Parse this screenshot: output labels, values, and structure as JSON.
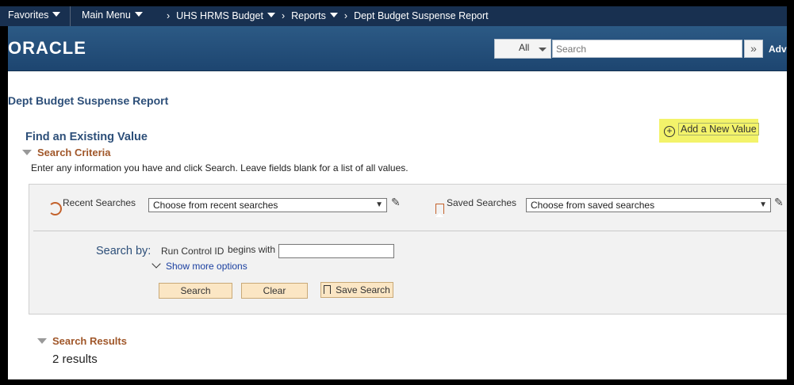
{
  "navbar": {
    "favorites": "Favorites",
    "main_menu": "Main Menu",
    "breadcrumbs": [
      "UHS HRMS Budget",
      "Reports",
      "Dept Budget Suspense Report"
    ]
  },
  "header": {
    "logo": "ORACLE",
    "search_scope": "All",
    "search_placeholder": "Search",
    "advanced": "Adv"
  },
  "page": {
    "title": "Dept Budget Suspense Report",
    "find_title": "Find an Existing Value",
    "add_new": "Add a New Value"
  },
  "search_criteria": {
    "heading": "Search Criteria",
    "instructions": "Enter any information you have and click Search. Leave fields blank for a list of all values.",
    "recent_label": "Recent Searches",
    "recent_value": "Choose from recent searches",
    "saved_label": "Saved Searches",
    "saved_value": "Choose from saved searches",
    "search_by_label": "Search by:",
    "field_label": "Run Control ID",
    "operator": "begins with",
    "more_options": "Show more options",
    "buttons": {
      "search": "Search",
      "clear": "Clear",
      "save_search": "Save Search"
    }
  },
  "search_results": {
    "heading": "Search Results",
    "count": "2 results"
  }
}
